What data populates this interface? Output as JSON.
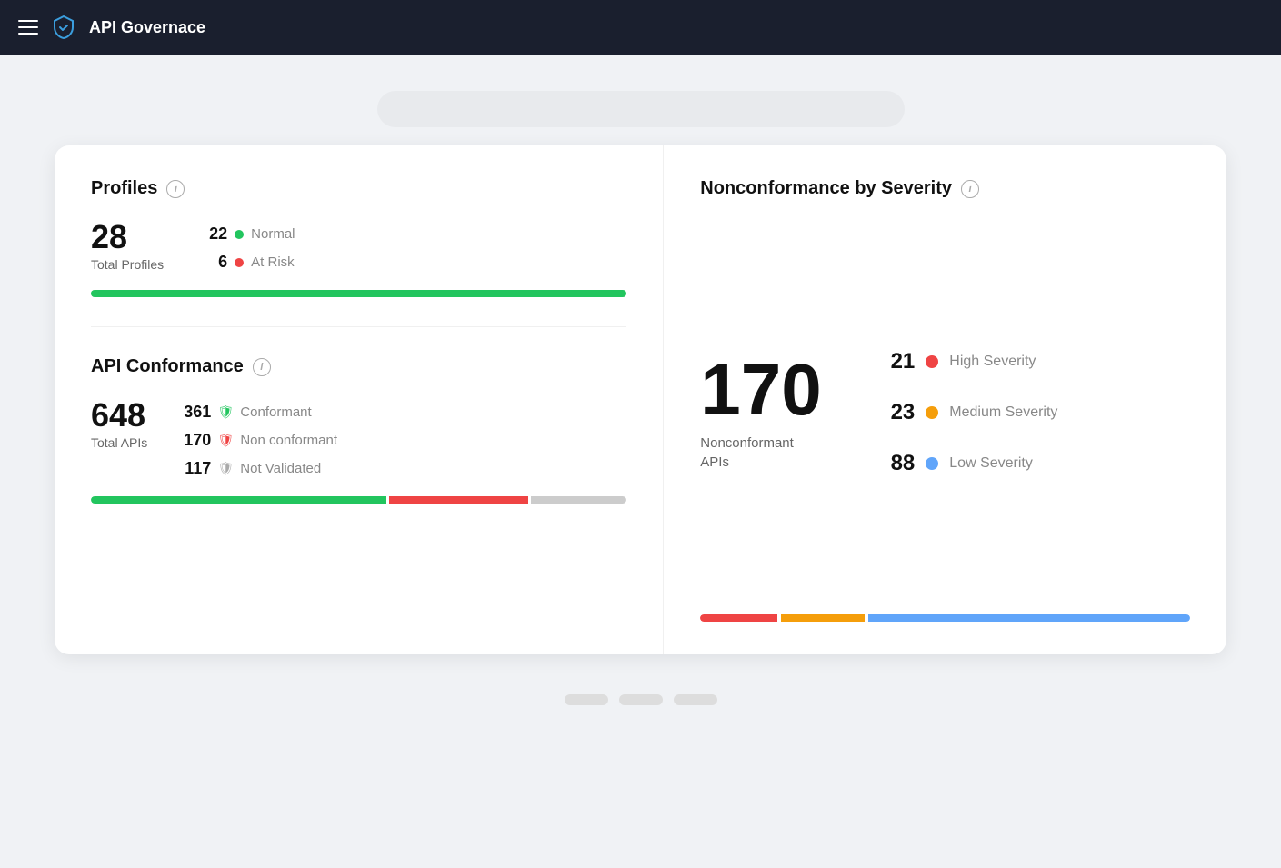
{
  "navbar": {
    "title": "API Governace",
    "hamburger_label": "Menu"
  },
  "profiles": {
    "section_title": "Profiles",
    "info_label": "i",
    "total": "28",
    "total_label": "Total Profiles",
    "normal_count": "22",
    "normal_label": "Normal",
    "at_risk_count": "6",
    "at_risk_label": "At Risk"
  },
  "api_conformance": {
    "section_title": "API  Conformance",
    "info_label": "i",
    "total": "648",
    "total_label": "Total APIs",
    "conformant_count": "361",
    "conformant_label": "Conformant",
    "non_conformant_count": "170",
    "non_conformant_label": "Non conformant",
    "not_validated_count": "117",
    "not_validated_label": "Not Validated"
  },
  "nonconformance": {
    "section_title": "Nonconformance by Severity",
    "info_label": "i",
    "total": "170",
    "total_label": "Nonconformant\nAPIs",
    "high_count": "21",
    "high_label": "High Severity",
    "medium_count": "23",
    "medium_label": "Medium Severity",
    "low_count": "88",
    "low_label": "Low Severity"
  },
  "colors": {
    "green": "#22c55e",
    "red": "#ef4444",
    "orange": "#f59e0b",
    "blue": "#60a5fa",
    "gray": "#cccccc"
  }
}
